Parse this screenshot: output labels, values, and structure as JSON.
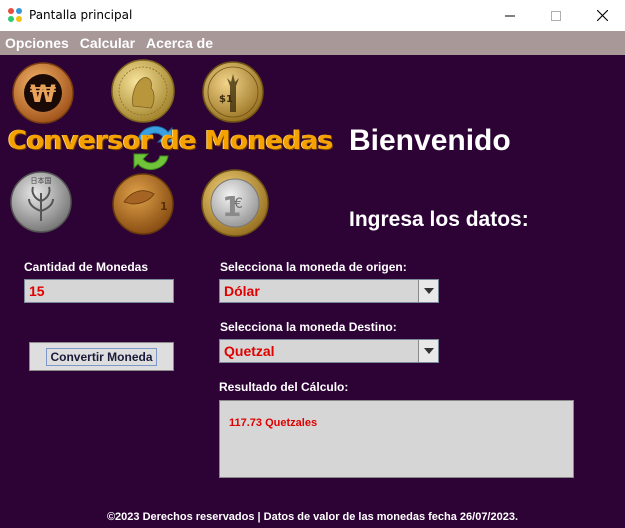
{
  "window": {
    "title": "Pantalla principal"
  },
  "menu": {
    "items": [
      "Opciones",
      "Calcular",
      "Acerca de"
    ]
  },
  "header": {
    "logo_text": "Conversor de Monedas",
    "welcome": "Bienvenido",
    "subtitle": "Ingresa los datos:"
  },
  "form": {
    "amount_label": "Cantidad de Monedas",
    "amount_value": "15",
    "origin_label": "Selecciona la moneda de origen:",
    "origin_value": "Dólar",
    "target_label": "Selecciona la moneda Destino:",
    "target_value": "Quetzal",
    "convert_button": "Convertir Moneda",
    "result_label": "Resultado del Cálculo:",
    "result_value": "117.73 Quetzales"
  },
  "footer": {
    "text": "©2023 Derechos reservados | Datos de valor de las monedas fecha 26/07/2023."
  },
  "colors": {
    "background": "#2d0336",
    "menubar": "#a89898",
    "accent_red": "#e00000",
    "logo_orange": "#f5a200"
  }
}
